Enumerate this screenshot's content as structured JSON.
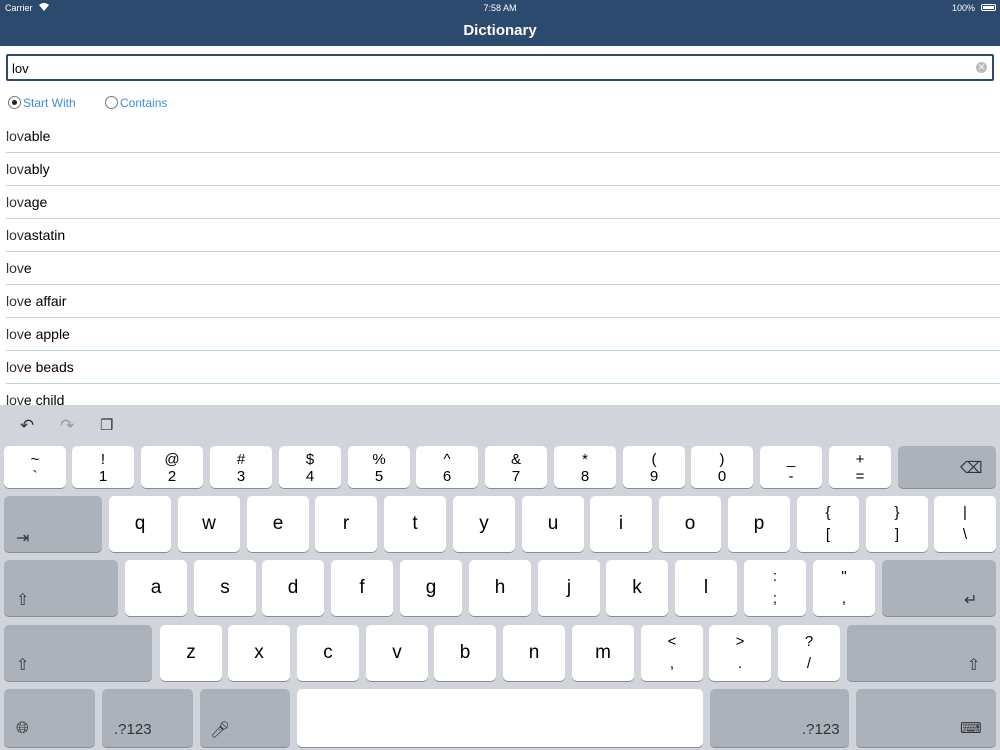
{
  "status_bar": {
    "carrier": "Carrier",
    "wifi": "wifi-icon",
    "time": "7:58 AM",
    "battery_pct": "100%"
  },
  "nav": {
    "title": "Dictionary"
  },
  "search": {
    "value": "lov",
    "clear_icon": "clear-icon"
  },
  "filter": {
    "options": [
      {
        "label": "Start With",
        "selected": true
      },
      {
        "label": "Contains",
        "selected": false
      }
    ],
    "accent_color": "#3b8fd6"
  },
  "results": [
    {
      "prefix": "lov",
      "rest": "able"
    },
    {
      "prefix": "lov",
      "rest": "ably"
    },
    {
      "prefix": "lov",
      "rest": "age"
    },
    {
      "prefix": "lov",
      "rest": "astatin"
    },
    {
      "prefix": "lov",
      "rest": "e"
    },
    {
      "prefix": "lov",
      "rest": "e affair"
    },
    {
      "prefix": "lov",
      "rest": "e apple"
    },
    {
      "prefix": "lov",
      "rest": "e beads"
    },
    {
      "prefix": "lov",
      "rest": "e child"
    }
  ],
  "keyboard": {
    "shortcuts": [
      "undo-icon",
      "redo-icon",
      "paste-icon"
    ],
    "number_row": [
      [
        "~",
        "`"
      ],
      [
        "!",
        "1"
      ],
      [
        "@",
        "2"
      ],
      [
        "#",
        "3"
      ],
      [
        "$",
        "4"
      ],
      [
        "%",
        "5"
      ],
      [
        "^",
        "6"
      ],
      [
        "&",
        "7"
      ],
      [
        "*",
        "8"
      ],
      [
        "(",
        "9"
      ],
      [
        ")",
        "0"
      ],
      [
        "_",
        "-"
      ],
      [
        "+",
        "="
      ]
    ],
    "row1": [
      "q",
      "w",
      "e",
      "r",
      "t",
      "y",
      "u",
      "i",
      "o",
      "p"
    ],
    "row1_symbols": [
      [
        "{",
        "["
      ],
      [
        "}",
        "]"
      ],
      [
        "|",
        "\\"
      ]
    ],
    "row2": [
      "a",
      "s",
      "d",
      "f",
      "g",
      "h",
      "j",
      "k",
      "l"
    ],
    "row2_symbols": [
      [
        ":",
        ";"
      ],
      [
        "\"",
        ","
      ]
    ],
    "row3": [
      "z",
      "x",
      "c",
      "v",
      "b",
      "n",
      "m"
    ],
    "row3_symbols": [
      [
        "<",
        ","
      ],
      [
        ">",
        "."
      ],
      [
        "?",
        "/"
      ]
    ],
    "mode_key_label": ".?123",
    "icons": {
      "tab": "tab-icon",
      "shift": "shift-icon",
      "backspace": "backspace-icon",
      "return": "return-icon",
      "globe": "globe-icon",
      "mic": "microphone-icon",
      "hide": "keyboard-hide-icon"
    }
  },
  "colors": {
    "nav_bg": "#2c4a6e",
    "keyboard_bg": "#d1d4da",
    "divider": "#b8d6cf"
  }
}
